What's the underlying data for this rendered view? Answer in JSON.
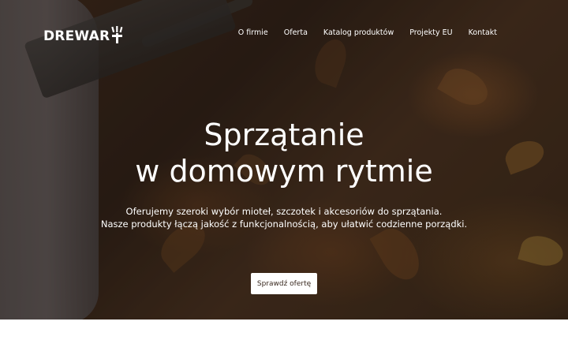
{
  "brand": {
    "name": "DREWART",
    "logo_text": "DREWAR"
  },
  "nav": {
    "items": [
      {
        "label": "O firmie"
      },
      {
        "label": "Oferta"
      },
      {
        "label": "Katalog produktów"
      },
      {
        "label": "Projekty EU"
      },
      {
        "label": "Kontakt"
      }
    ]
  },
  "hero": {
    "title_line1": "Sprzątanie",
    "title_line2": "w domowym rytmie",
    "subtitle_line1": "Oferujemy szeroki wybór mioteł, szczotek i akcesoriów do sprzątania.",
    "subtitle_line2": "Nasze produkty łączą jakość z funkcjonalnością, aby ułatwić codzienne porządki.",
    "cta_label": "Sprawdź ofertę"
  },
  "colors": {
    "text_on_hero": "#ffffff",
    "cta_background": "#ffffff",
    "page_background": "#ffffff"
  }
}
